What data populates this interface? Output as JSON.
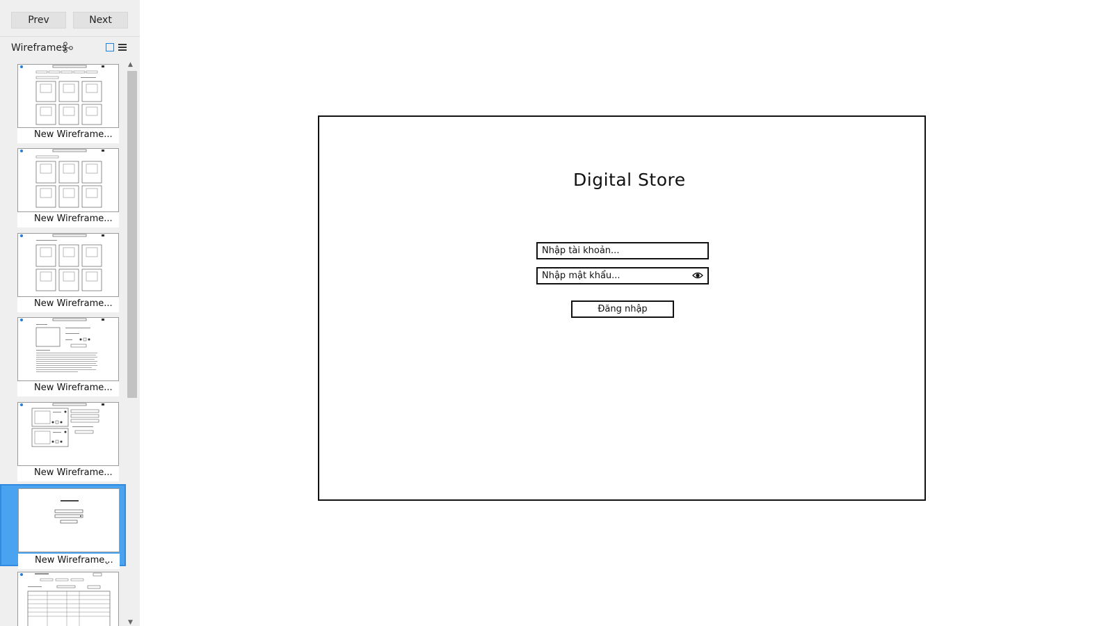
{
  "nav": {
    "prev_label": "Prev",
    "next_label": "Next"
  },
  "sidebar": {
    "title": "Wireframes",
    "items": [
      {
        "label": "New Wireframe..."
      },
      {
        "label": "New Wireframe..."
      },
      {
        "label": "New Wireframe..."
      },
      {
        "label": "New Wireframe..."
      },
      {
        "label": "New Wireframe..."
      },
      {
        "label": "New Wireframe...",
        "selected": true
      },
      {
        "label": ""
      }
    ]
  },
  "canvas": {
    "title": "Digital Store",
    "username_placeholder": "Nhập tài khoản...",
    "password_placeholder": "Nhập mật khẩu...",
    "login_label": "Đăng nhập"
  },
  "colors": {
    "selection": "#4aa3f0",
    "accent": "#1d7fe0"
  }
}
